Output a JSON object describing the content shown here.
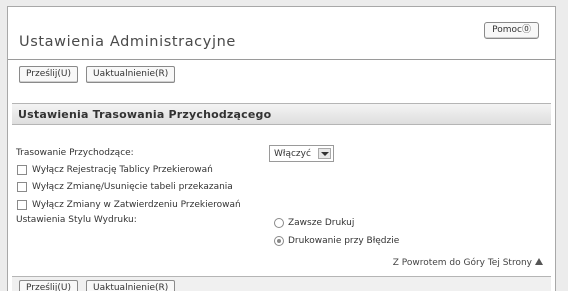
{
  "header": {
    "title": "Ustawienia Administracyjne",
    "help_label": "Pomoc⓪"
  },
  "toolbar": {
    "submit_label": "Prześlij(U)",
    "update_label": "Uaktualnienie(R)"
  },
  "section": {
    "title": "Ustawienia Trasowania Przychodzącego"
  },
  "form": {
    "incoming_routing_label": "Trasowanie Przychodzące:",
    "incoming_routing_value": "Włączyć",
    "checkboxes": [
      {
        "label": "Wyłącz Rejestrację Tablicy Przekierowań",
        "checked": false
      },
      {
        "label": "Wyłącz Zmianę/Usunięcie tabeli przekazania",
        "checked": false
      },
      {
        "label": "Wyłącz Zmiany w Zatwierdzeniu Przekierowań",
        "checked": false
      }
    ],
    "print_style_label": "Ustawienia Stylu Wydruku:",
    "print_style_options": [
      {
        "label": "Zawsze Drukuj",
        "selected": false
      },
      {
        "label": "Drukowanie przy Błędzie",
        "selected": true
      }
    ]
  },
  "footer": {
    "back_to_top_label": "Z Powrotem do Góry Tej Strony"
  }
}
